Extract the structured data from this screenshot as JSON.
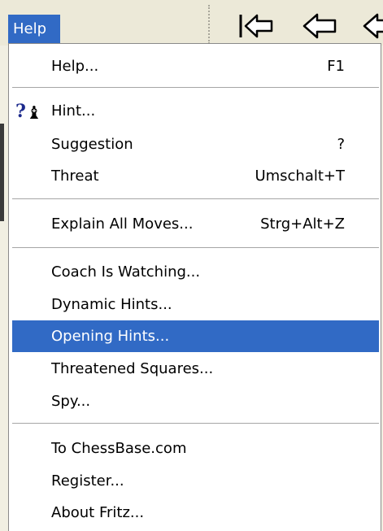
{
  "menubar": {
    "active_menu": "Help"
  },
  "toolbar": {
    "icons": [
      "go-to-start-icon",
      "back-icon",
      "next-icon"
    ]
  },
  "menu": {
    "items": [
      {
        "label": "Help...",
        "shortcut": "F1",
        "highlighted": false
      },
      {
        "label": "Hint...",
        "shortcut": "",
        "icon": "hint-icon",
        "highlighted": false
      },
      {
        "label": "Suggestion",
        "shortcut": "?",
        "highlighted": false
      },
      {
        "label": "Threat",
        "shortcut": "Umschalt+T",
        "highlighted": false
      },
      {
        "label": "Explain All Moves...",
        "shortcut": "Strg+Alt+Z",
        "highlighted": false
      },
      {
        "label": "Coach Is Watching...",
        "shortcut": "",
        "highlighted": false
      },
      {
        "label": "Dynamic Hints...",
        "shortcut": "",
        "highlighted": false
      },
      {
        "label": "Opening Hints...",
        "shortcut": "",
        "highlighted": true
      },
      {
        "label": "Threatened Squares...",
        "shortcut": "",
        "highlighted": false
      },
      {
        "label": "Spy...",
        "shortcut": "",
        "highlighted": false
      },
      {
        "label": "To ChessBase.com",
        "shortcut": "",
        "highlighted": false
      },
      {
        "label": "Register...",
        "shortcut": "",
        "highlighted": false
      },
      {
        "label": "About Fritz...",
        "shortcut": "",
        "highlighted": false
      }
    ]
  },
  "colors": {
    "highlight": "#316ac5",
    "menu_background": "#ffffff",
    "bar_background": "#ece9d8"
  }
}
